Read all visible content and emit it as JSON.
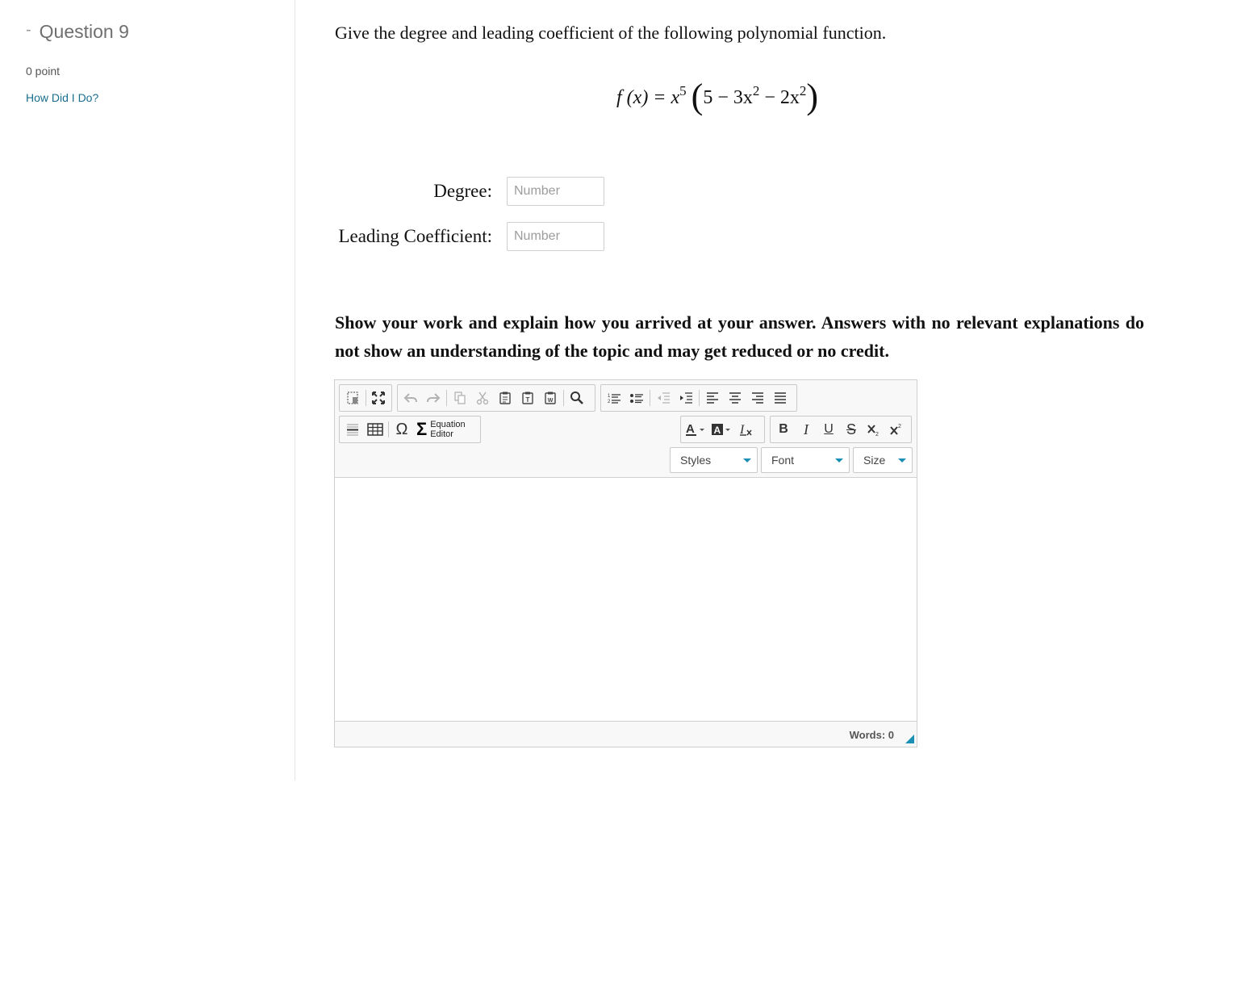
{
  "sidebar": {
    "dash": "-",
    "question_title": "Question 9",
    "points": "0 point",
    "link": "How Did I Do?"
  },
  "question": {
    "prompt": "Give the degree and leading coefficient of the following polynomial function.",
    "formula": {
      "lhs": "f (x) = x",
      "exp1": "5",
      "inner_a": "5 − 3x",
      "exp2": "2",
      "inner_b": " − 2x",
      "exp3": "2"
    },
    "degree_label": "Degree:",
    "degree_placeholder": "Number",
    "leading_label": "Leading Coefficient:",
    "leading_placeholder": "Number",
    "instructions": "Show your work and explain how you arrived at your answer. Answers with no relevant explanations do not show an understanding of the topic and may get reduced or no credit."
  },
  "editor": {
    "equation_editor_line1": "Equation",
    "equation_editor_line2": "Editor",
    "styles_label": "Styles",
    "font_label": "Font",
    "size_label": "Size",
    "words": "Words: 0",
    "accent_color": "#1b8fb4",
    "toolbar_icons": [
      "source-icon",
      "maximize-icon",
      "undo-icon",
      "redo-icon",
      "copy-icon",
      "cut-icon",
      "paste-icon",
      "paste-text-icon",
      "paste-word-icon",
      "find-icon",
      "numbered-list-icon",
      "bulleted-list-icon",
      "outdent-icon",
      "indent-icon",
      "align-left-icon",
      "align-center-icon",
      "align-right-icon",
      "justify-icon",
      "horizontal-line-icon",
      "table-icon",
      "special-char-icon",
      "sigma-icon",
      "text-color-icon",
      "background-color-icon",
      "remove-format-icon",
      "bold-icon",
      "italic-icon",
      "underline-icon",
      "strikethrough-icon",
      "subscript-icon",
      "superscript-icon"
    ]
  }
}
